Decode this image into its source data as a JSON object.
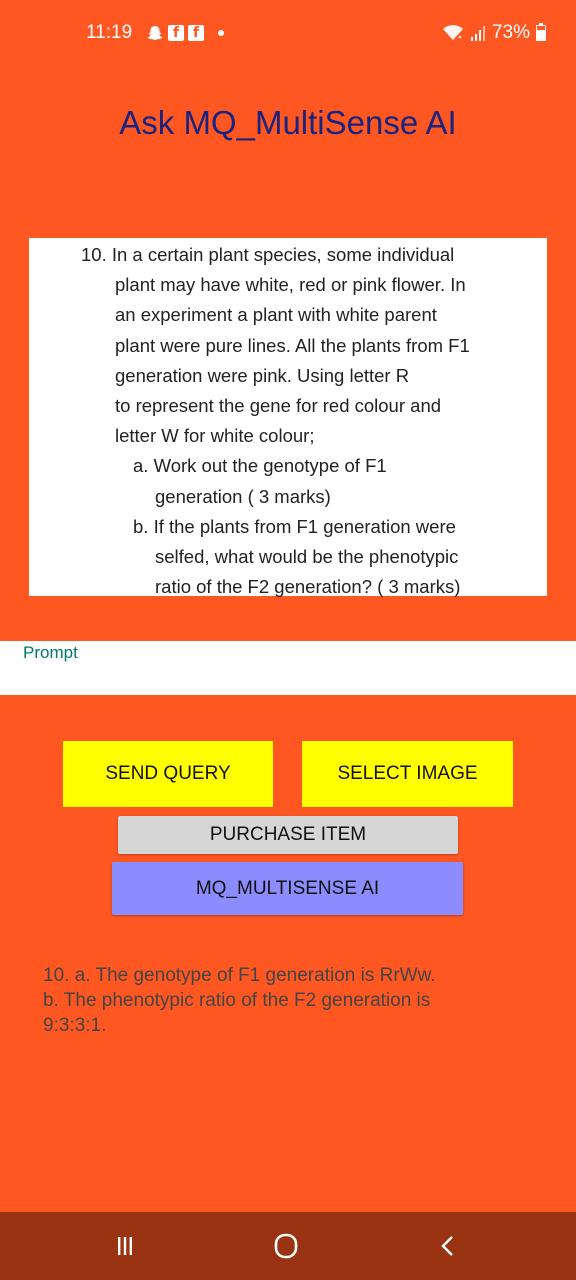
{
  "status_bar": {
    "time": "11:19",
    "battery_text": "73%",
    "battery_level": 0.73,
    "icons_left": [
      "snapchat-icon",
      "facebook-icon",
      "facebook-icon",
      "notification-dot-icon"
    ],
    "icons_right": [
      "wifi-icon",
      "signal-icon",
      "battery-icon"
    ]
  },
  "app": {
    "title": "Ask MQ_MultiSense AI"
  },
  "question_image": {
    "lines": [
      "10. In a certain plant species, some individual",
      "plant may have white, red or pink flower. In",
      "an experiment a plant with white parent",
      "plant were pure lines. All the plants from F1",
      "generation were pink. Using letter R",
      "to represent the gene for red colour and",
      "letter W for white colour;",
      "a. Work out the genotype of F1",
      "generation ( 3 marks)",
      "b. If the plants from F1 generation were",
      "selfed, what would be the phenotypic",
      "ratio of the F2 generation? ( 3 marks)"
    ]
  },
  "prompt": {
    "label": "Prompt",
    "value": ""
  },
  "buttons": {
    "send_query": "SEND QUERY",
    "select_image": "SELECT IMAGE",
    "purchase_item": "PURCHASE ITEM",
    "mq_multisense": "MQ_MULTISENSE AI"
  },
  "answer": {
    "text": "  10. a. The genotype of F1 generation is RrWw.\nb. The phenotypic ratio of the F2 generation is\n9:3:3:1."
  },
  "colors": {
    "background": "#FF5722",
    "title": "#1A237E",
    "yellow_button": "#FFFF00",
    "gray_button": "#D6D6D6",
    "purple_button": "#8C8CFF",
    "nav_bar": "#993311"
  },
  "nav_bar": {
    "buttons": [
      "recents-icon",
      "home-icon",
      "back-icon"
    ]
  }
}
